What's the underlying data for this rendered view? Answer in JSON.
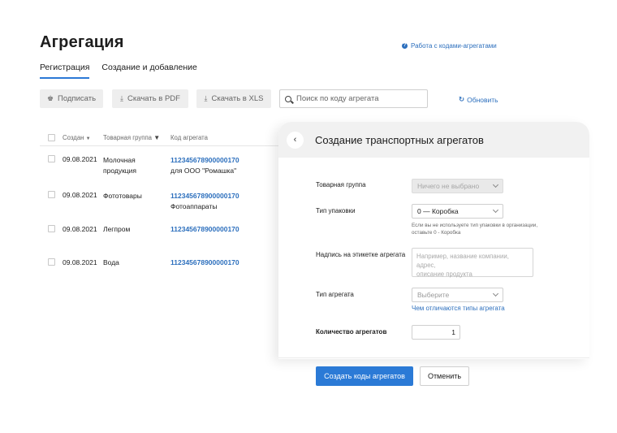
{
  "page": {
    "title": "Агрегация",
    "help_link": "Работа с кодами-агрегатами",
    "tabs": [
      {
        "label": "Регистрация",
        "active": true
      },
      {
        "label": "Создание и добавление",
        "active": false
      }
    ]
  },
  "toolbar": {
    "sign_label": "Подписать",
    "pdf_label": "Скачать в PDF",
    "xls_label": "Скачать в XLS",
    "search_placeholder": "Поиск по коду агрегата",
    "refresh_label": "Обновить"
  },
  "table": {
    "headers": {
      "created": "Создан",
      "group": "Товарная группа",
      "code": "Код агрегата"
    },
    "rows": [
      {
        "date": "09.08.2021",
        "group_line1": "Молочная",
        "group_line2": "продукция",
        "code": "112345678900000170",
        "owner": "для ООО \"Ромашка\""
      },
      {
        "date": "09.08.2021",
        "group_line1": "Фототовары",
        "group_line2": "",
        "code": "112345678900000170",
        "owner": "Фотоаппараты"
      },
      {
        "date": "09.08.2021",
        "group_line1": "Легпром",
        "group_line2": "",
        "code": "112345678900000170",
        "owner": ""
      },
      {
        "date": "09.08.2021",
        "group_line1": "Вода",
        "group_line2": "",
        "code": "112345678900000170",
        "owner": ""
      }
    ]
  },
  "modal": {
    "title": "Создание транспортных агрегатов",
    "fields": {
      "product_group": {
        "label": "Товарная группа",
        "value": "Ничего не выбрано"
      },
      "package_type": {
        "label": "Тип упаковки",
        "value": "0 — Коробка",
        "hint_line1": "Если вы не используете тип упаковки в организации,",
        "hint_line2": "оставьте 0 - Коробка"
      },
      "label_text": {
        "label": "Надпись на этикетке агрегата",
        "placeholder_line1": "Например, название компании, адрес,",
        "placeholder_line2": "описание продукта"
      },
      "aggregate_type": {
        "label": "Тип агрегата",
        "placeholder": "Выберите",
        "link": "Чем отличаются типы агрегата"
      },
      "quantity": {
        "label": "Количество агрегатов",
        "value": "1"
      }
    },
    "buttons": {
      "create": "Создать коды агрегатов",
      "cancel": "Отменить"
    }
  },
  "colors": {
    "accent": "#2b7ad6",
    "link": "#2c6fbd"
  }
}
